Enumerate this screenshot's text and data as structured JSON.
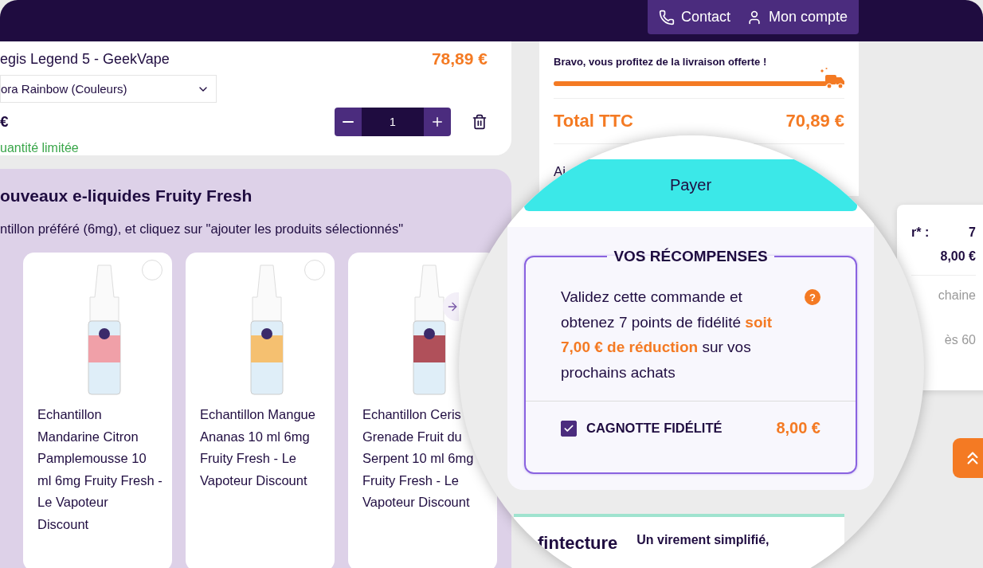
{
  "header": {
    "links": [
      {
        "label": "Contact"
      },
      {
        "label": "Mon compte"
      }
    ]
  },
  "cart_item": {
    "name": "egis Legend 5 - GeekVape",
    "price": "78,89 €",
    "variant": "ora Rainbow (Couleurs)",
    "unit_price": "€",
    "quantity": "1",
    "stock_note": "uantité limitée"
  },
  "samples": {
    "title": "ouveaux e-liquides Fruity Fresh",
    "subtitle": "ntillon préféré (6mg), et cliquez sur \"ajouter les produits sélectionnés\"",
    "products": [
      {
        "name": "Echantillon Mandarine Citron Pamplemousse 10 ml 6mg Fruity Fresh - Le Vapoteur Discount",
        "selected": false,
        "color": "#f0a0a8"
      },
      {
        "name": "Echantillon Mangue Ananas 10 ml 6mg Fruity Fresh - Le Vapoteur Discount",
        "selected": false,
        "color": "#f5c070"
      },
      {
        "name": "Echantillon Ceris Grenade Fruit du Serpent 10 ml 6mg Fruity Fresh - Le Vapoteur Discount",
        "color": "#b0505a"
      }
    ]
  },
  "summary": {
    "shipping_note": "Bravo, vous profitez de la livraison offerte !",
    "shipping": {
      "level": 1
    },
    "total_label": "Total TTC",
    "total": "70,89 €",
    "partial_text": "Aj"
  },
  "side_card": {
    "rows": [
      {
        "label": "r* :",
        "value": "7"
      },
      {
        "value": "8,00 €"
      }
    ],
    "notes": [
      "chaine",
      "ès 60"
    ]
  },
  "magnifier": {
    "pay_button": "Payer",
    "rewards": {
      "title": "VOS RÉCOMPENSES",
      "message": "Validez cette commande et obtenez 7 points de fidélité **soit 7,00 € de réduction** sur vos prochains achats",
      "help": "?",
      "cagnotte": {
        "label": "CAGNOTTE FIDÉLITÉ",
        "amount": "8,00 €",
        "checked": true
      }
    },
    "payment": {
      "logo": "fintecture",
      "tagline": "Un virement simplifié,"
    }
  }
}
